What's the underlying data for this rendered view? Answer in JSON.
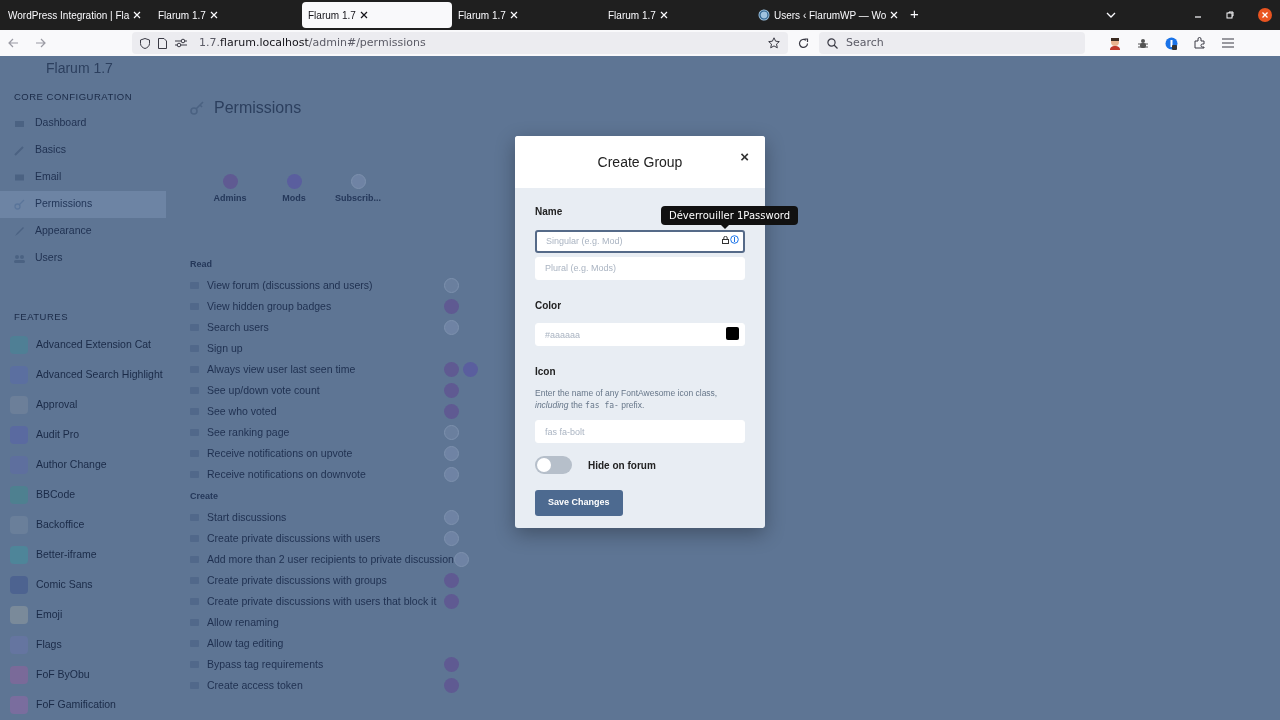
{
  "browser": {
    "tabs": [
      {
        "title": "WordPress Integration | Fla",
        "kind": "plain",
        "selected": false
      },
      {
        "title": "Flarum 1.7",
        "kind": "plain",
        "selected": false
      },
      {
        "title": "Flarum 1.7",
        "kind": "plain",
        "selected": true
      },
      {
        "title": "Flarum 1.7",
        "kind": "plain",
        "selected": false
      },
      {
        "title": "Flarum 1.7",
        "kind": "plain",
        "selected": false
      },
      {
        "title": "Users ‹ FlarumWP — Wo",
        "kind": "site",
        "selected": false
      }
    ],
    "new_tab": "+",
    "address": {
      "prefix": "1.7.",
      "host": "flarum.localhost",
      "path": "/admin#/permissions"
    },
    "search": {
      "placeholder": "Search"
    }
  },
  "admin": {
    "site_title": "Flarum 1.7",
    "sidebar": {
      "section": "CORE CONFIGURATION",
      "items": [
        {
          "label": "Dashboard",
          "selected": false
        },
        {
          "label": "Basics",
          "selected": false
        },
        {
          "label": "Email",
          "selected": false
        },
        {
          "label": "Permissions",
          "selected": true
        },
        {
          "label": "Appearance",
          "selected": false
        },
        {
          "label": "Users",
          "selected": false
        }
      ],
      "extensions_section": "FEATURES",
      "extensions": [
        {
          "label": "Advanced Extension Cat",
          "color": "#4f7f95"
        },
        {
          "label": "Advanced Search Highlight",
          "color": "#5b6fa0"
        },
        {
          "label": "Approval",
          "color": "#6c7f99"
        },
        {
          "label": "Audit Pro",
          "color": "#5a6aa0"
        },
        {
          "label": "Author Change",
          "color": "#5e6f9e"
        },
        {
          "label": "BBCode",
          "color": "#4e8090"
        },
        {
          "label": "Backoffice",
          "color": "#6a7f9a"
        },
        {
          "label": "Better-iframe",
          "color": "#4e8599"
        },
        {
          "label": "Comic Sans",
          "color": "#4d6390"
        },
        {
          "label": "Emoji",
          "color": "#7a8a9a"
        },
        {
          "label": "Flags",
          "color": "#6575a0"
        },
        {
          "label": "FoF ByObu",
          "color": "#7a6a99"
        },
        {
          "label": "FoF Gamification",
          "color": "#7a6d9e"
        }
      ]
    },
    "page_title": "Permissions",
    "groups": [
      {
        "label": "Admins",
        "kind": "admin"
      },
      {
        "label": "Mods",
        "kind": "mod"
      },
      {
        "label": "Subscrib...",
        "kind": "member"
      }
    ],
    "sections": [
      {
        "title": "Read",
        "rows": [
          {
            "label": "View forum (discussions and users)",
            "badges": [
              {
                "kind": "everyone"
              }
            ]
          },
          {
            "label": "View hidden group badges",
            "badges": [
              {
                "kind": "admin"
              }
            ]
          },
          {
            "label": "Search users",
            "badges": [
              {
                "kind": "member"
              }
            ]
          },
          {
            "label": "Sign up"
          },
          {
            "label": "Always view user last seen time",
            "badges": [
              {
                "kind": "admin"
              },
              {
                "kind": "mod"
              }
            ]
          },
          {
            "label": "See up/down vote count",
            "badges": [
              {
                "kind": "admin"
              }
            ]
          },
          {
            "label": "See who voted",
            "badges": [
              {
                "kind": "admin"
              }
            ]
          },
          {
            "label": "See ranking page",
            "badges": [
              {
                "kind": "everyone"
              }
            ]
          },
          {
            "label": "Receive notifications on upvote",
            "badges": [
              {
                "kind": "member"
              }
            ]
          },
          {
            "label": "Receive notifications on downvote",
            "badges": [
              {
                "kind": "member"
              }
            ]
          }
        ]
      },
      {
        "title": "Create",
        "rows": [
          {
            "label": "Start discussions",
            "badges": [
              {
                "kind": "member"
              }
            ]
          },
          {
            "label": "Create private discussions with users",
            "badges": [
              {
                "kind": "member"
              }
            ]
          },
          {
            "label": "Add more than 2 user recipients to private discussion",
            "badges": [
              {
                "kind": "member"
              }
            ]
          },
          {
            "label": "Create private discussions with groups",
            "badges": [
              {
                "kind": "admin"
              }
            ]
          },
          {
            "label": "Create private discussions with users that block it",
            "badges": [
              {
                "kind": "admin"
              }
            ]
          },
          {
            "label": "Allow renaming"
          },
          {
            "label": "Allow tag editing"
          },
          {
            "label": "Bypass tag requirements",
            "badges": [
              {
                "kind": "admin"
              }
            ]
          },
          {
            "label": "Create access token",
            "badges": [
              {
                "kind": "admin"
              }
            ]
          }
        ]
      }
    ]
  },
  "modal": {
    "title": "Create Group",
    "close": "×",
    "name_label": "Name",
    "singular_placeholder": "Singular (e.g. Mod)",
    "plural_placeholder": "Plural (e.g. Mods)",
    "tooltip": "Déverrouiller 1Password",
    "color_label": "Color",
    "color_placeholder": "#aaaaaa",
    "icon_label": "Icon",
    "icon_help": [
      {
        "kind": "text",
        "text": "Enter the name of any FontAwesome icon class, "
      },
      {
        "kind": "em",
        "text": "including"
      },
      {
        "kind": "text",
        "text": " the "
      },
      {
        "kind": "code",
        "text": "fas fa-"
      },
      {
        "kind": "text",
        "text": " prefix."
      }
    ],
    "icon_placeholder": "fas fa-bolt",
    "hide_on_forum": {
      "label": "Hide on forum",
      "on": false
    },
    "save": "Save Changes"
  }
}
